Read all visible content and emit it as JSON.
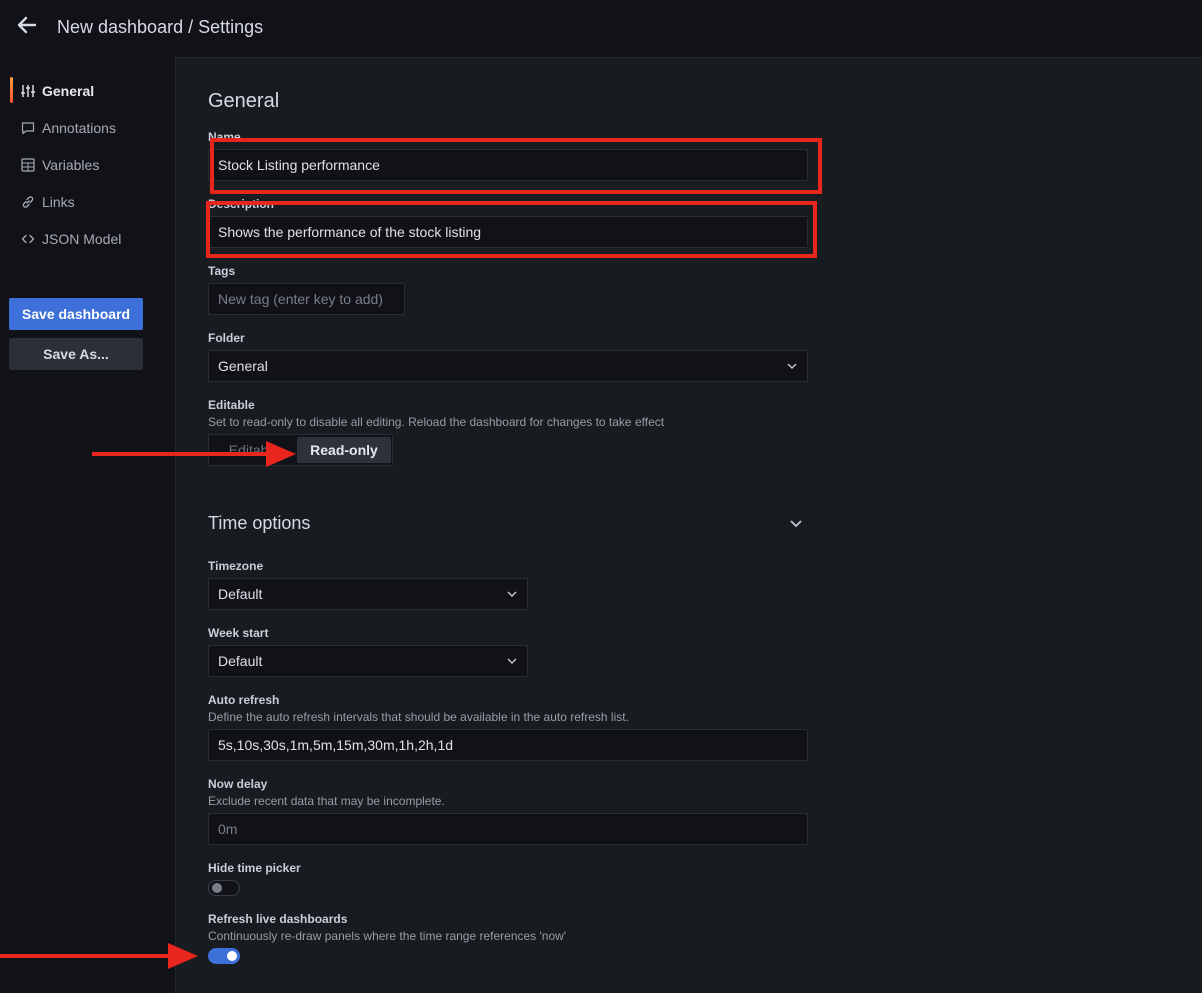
{
  "header": {
    "title": "New dashboard / Settings",
    "back_icon": "arrow-left-icon"
  },
  "sidebar": {
    "items": [
      {
        "label": "General",
        "icon": "sliders-icon",
        "active": true
      },
      {
        "label": "Annotations",
        "icon": "comment-icon",
        "active": false
      },
      {
        "label": "Variables",
        "icon": "calculator-icon",
        "active": false
      },
      {
        "label": "Links",
        "icon": "link-icon",
        "active": false
      },
      {
        "label": "JSON Model",
        "icon": "code-icon",
        "active": false
      }
    ],
    "save_label": "Save dashboard",
    "save_as_label": "Save As..."
  },
  "general": {
    "heading": "General",
    "name_label": "Name",
    "name_value": "Stock Listing performance",
    "description_label": "Description",
    "description_value": "Shows the performance of the stock listing",
    "tags_label": "Tags",
    "tags_placeholder": "New tag (enter key to add)",
    "folder_label": "Folder",
    "folder_value": "General",
    "editable_label": "Editable",
    "editable_desc": "Set to read-only to disable all editing. Reload the dashboard for changes to take effect",
    "editable_option": "Editable",
    "readonly_option": "Read-only",
    "selected_mode": "Read-only"
  },
  "time_options": {
    "heading": "Time options",
    "timezone_label": "Timezone",
    "timezone_value": "Default",
    "week_start_label": "Week start",
    "week_start_value": "Default",
    "auto_refresh_label": "Auto refresh",
    "auto_refresh_desc": "Define the auto refresh intervals that should be available in the auto refresh list.",
    "auto_refresh_value": "5s,10s,30s,1m,5m,15m,30m,1h,2h,1d",
    "now_delay_label": "Now delay",
    "now_delay_desc": "Exclude recent data that may be incomplete.",
    "now_delay_placeholder": "0m",
    "hide_time_picker_label": "Hide time picker",
    "hide_time_picker_on": false,
    "refresh_live_label": "Refresh live dashboards",
    "refresh_live_desc": "Continuously re-draw panels where the time range references 'now'",
    "refresh_live_on": true
  },
  "colors": {
    "accent": "#3d71d9",
    "annotation": "#e8261d",
    "background": "#111217",
    "panel": "#181b1f"
  }
}
